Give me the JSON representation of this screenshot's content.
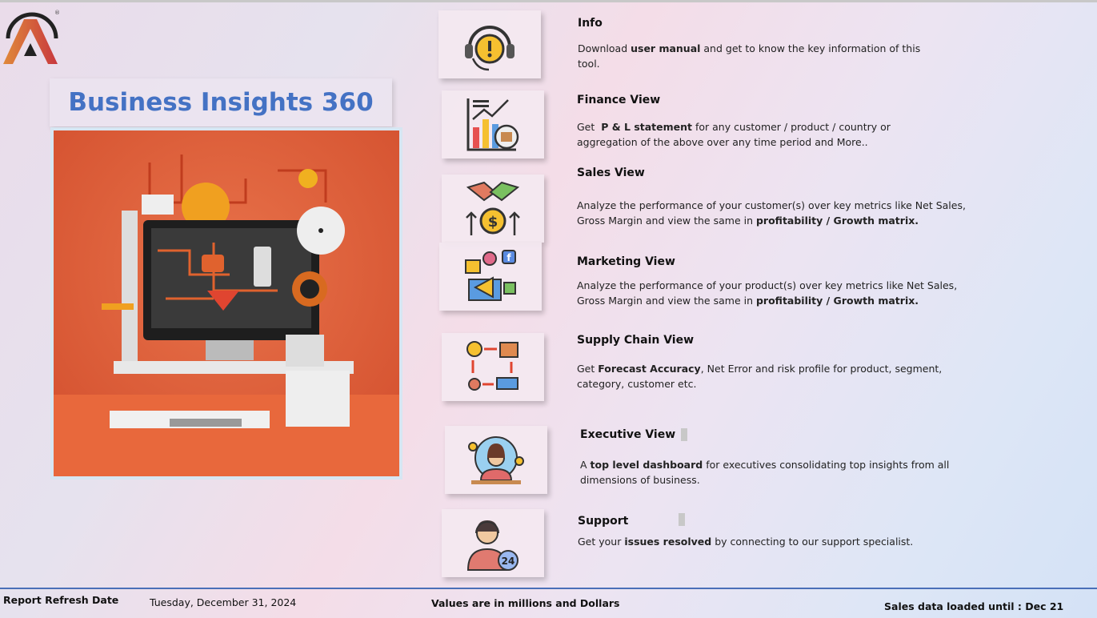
{
  "brand": {
    "title": "Business Insights 360",
    "logo_mark": "®"
  },
  "items": [
    {
      "title": "Info",
      "pre": "Download ",
      "bold": "user manual",
      "post": " and get to know the key information of this tool.",
      "icon": "headset-alert-icon"
    },
    {
      "title": "Finance View",
      "pre": "Get  ",
      "bold": "P & L statement",
      "post": " for any customer / product / country or aggregation of the above over any time period and More..",
      "icon": "finance-chart-icon"
    },
    {
      "title": "Sales View",
      "pre": "Analyze the performance of your customer(s) over key metrics like Net Sales, Gross Margin and view the same in ",
      "bold": "profitability / Growth matrix.",
      "post": "",
      "icon": "handshake-dollar-icon"
    },
    {
      "title": "Marketing View",
      "pre": "Analyze the performance of your product(s) over key metrics like Net Sales, Gross Margin and view the same in ",
      "bold": "profitability / Growth matrix.",
      "post": "",
      "icon": "megaphone-icon"
    },
    {
      "title": "Supply Chain View",
      "pre": "Get ",
      "bold": "Forecast Accuracy",
      "post": ", Net Error and risk profile for product, segment, category, customer etc.",
      "icon": "supply-chain-icon"
    },
    {
      "title": "Executive View",
      "pre": "A ",
      "bold": "top level dashboard",
      "post": " for executives consolidating top insights from all dimensions of business.",
      "icon": "executive-globe-icon"
    },
    {
      "title": "Support",
      "pre": "Get your ",
      "bold": "issues resolved",
      "post": " by connecting to our support specialist.",
      "icon": "support-agent-icon"
    }
  ],
  "footer": {
    "refresh_label": "Report Refresh Date",
    "refresh_date": "Tuesday, December 31, 2024",
    "units_note": "Values are in millions and Dollars",
    "loaded_until": "Sales data loaded until : Dec 21"
  }
}
